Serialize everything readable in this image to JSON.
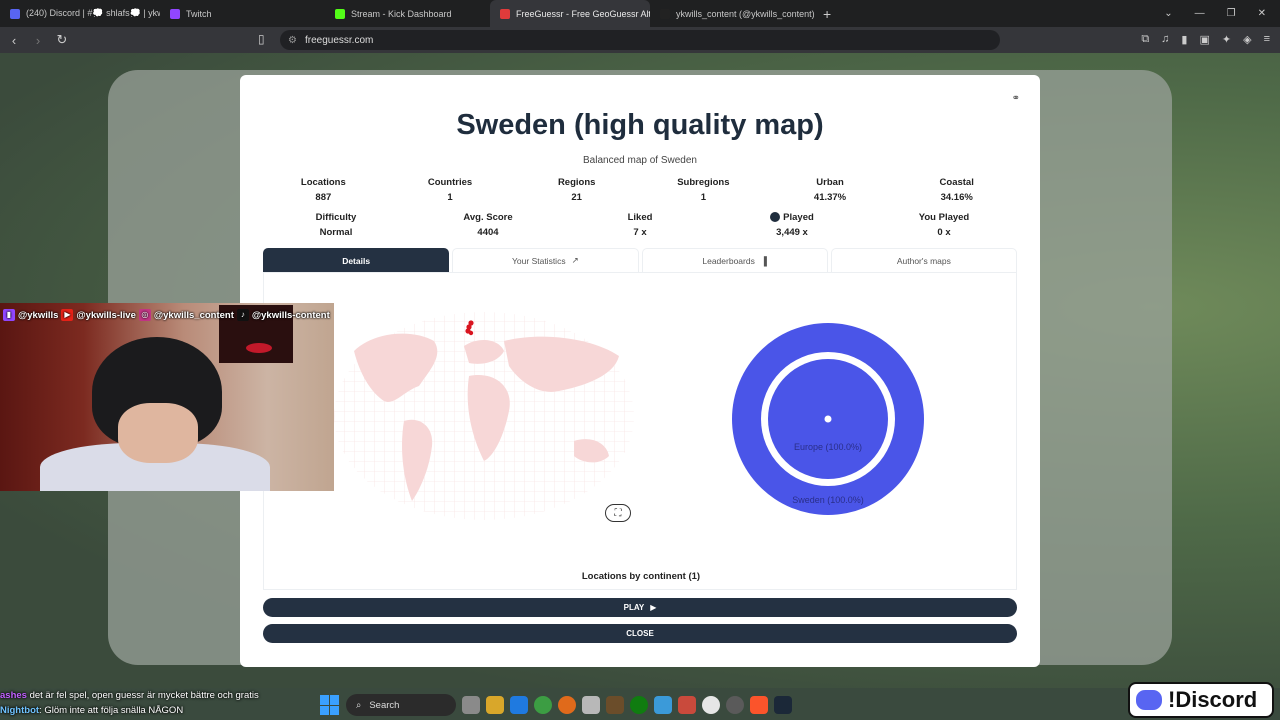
{
  "browser": {
    "tabs": [
      {
        "label": "(240) Discord | #💭 shlafs💭 | ykwills",
        "color": "#5865f2",
        "active": false
      },
      {
        "label": "Twitch",
        "color": "#9146ff",
        "active": false
      },
      {
        "label": "Stream - Kick Dashboard",
        "color": "#53fc18",
        "active": false
      },
      {
        "label": "FreeGuessr - Free GeoGuessr Alt",
        "color": "#e03b3b",
        "active": true
      },
      {
        "label": "ykwills_content (@ykwills_content) | ",
        "color": "#222222",
        "active": false
      }
    ],
    "url": "freeguessr.com"
  },
  "modal": {
    "title": "Sweden (high quality map)",
    "subtitle": "Balanced map of Sweden",
    "stats_row1": [
      {
        "label": "Locations",
        "value": "887"
      },
      {
        "label": "Countries",
        "value": "1"
      },
      {
        "label": "Regions",
        "value": "21"
      },
      {
        "label": "Subregions",
        "value": "1"
      },
      {
        "label": "Urban",
        "value": "41.37%"
      },
      {
        "label": "Coastal",
        "value": "34.16%"
      }
    ],
    "stats_row2": [
      {
        "label": "Difficulty",
        "value": "Normal"
      },
      {
        "label": "Avg. Score",
        "value": "4404"
      },
      {
        "label": "Liked",
        "value": "7 x"
      },
      {
        "label": "Played",
        "value": "3,449 x"
      },
      {
        "label": "You Played",
        "value": "0 x"
      }
    ],
    "tabs": [
      "Details",
      "Your Statistics",
      "Leaderboards",
      "Author's maps"
    ],
    "donut_inner_label": "Europe (100.0%)",
    "donut_outer_label": "Sweden (100.0%)",
    "continent_heading": "Locations by continent (1)",
    "play_label": "PLAY",
    "close_label": "CLOSE"
  },
  "chart_data": {
    "type": "pie",
    "rings": [
      {
        "level": "continent",
        "labels": [
          "Europe"
        ],
        "values": [
          100.0
        ]
      },
      {
        "level": "country",
        "labels": [
          "Sweden"
        ],
        "values": [
          100.0
        ]
      }
    ]
  },
  "overlay": {
    "socials": [
      "@ykwills",
      "@ykwills-live",
      "@ykwills_content",
      "@ykwills-content"
    ],
    "chat": [
      {
        "name": "ashes",
        "text": "det är fel spel, open guessr är mycket bättre och gratis"
      },
      {
        "name": "Nightbot",
        "text": "Glöm inte att följa snälla NÅGON"
      }
    ],
    "discord_text": "!Discord"
  },
  "taskbar": {
    "search_label": "Search"
  },
  "colors": {
    "accent": "#243142",
    "donut": "#4a55e8",
    "map_marker": "#d9141f"
  }
}
